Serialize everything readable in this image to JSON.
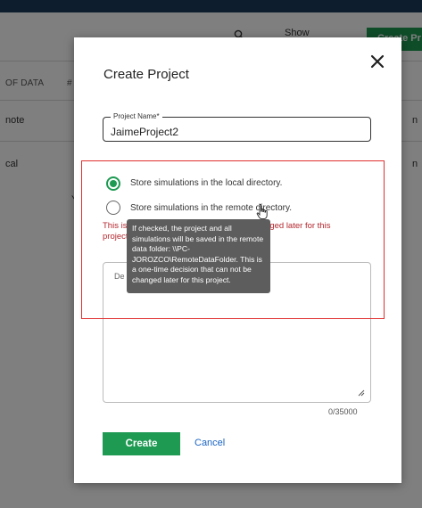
{
  "background": {
    "show_label": "Show",
    "create_button_label": "Create Pr",
    "column_header": "OF DATA",
    "column_hash": "#",
    "rows": [
      {
        "cell": "note",
        "right": "n"
      },
      {
        "cell": "cal",
        "right": "n"
      }
    ],
    "fragment": "Y"
  },
  "modal": {
    "title": "Create Project",
    "close_icon": "close-icon",
    "project_name": {
      "label": "Project Name*",
      "value": "JaimeProject2"
    },
    "storage": {
      "local_label": "Store simulations in the local directory.",
      "remote_label": "Store simulations in the remote directory.",
      "selected": "local"
    },
    "warning": {
      "line1_visible": "This is",
      "line1_end": "changed later for this",
      "line2_visible": "project"
    },
    "description": {
      "placeholder": "De",
      "counter": "0/35000"
    },
    "create_label": "Create",
    "cancel_label": "Cancel"
  },
  "tooltip": {
    "text": "If checked, the project and all simulations will be saved in the remote data folder: \\\\PC-JOROZCO\\RemoteDataFolder. This is a one-time decision that can not be changed later for this project."
  },
  "colors": {
    "accent_green": "#1e9a53",
    "warning_red": "#b3262d",
    "highlight_red": "#e0302e",
    "link_blue": "#1a64c2",
    "topbar_navy": "#1b3a5c"
  }
}
